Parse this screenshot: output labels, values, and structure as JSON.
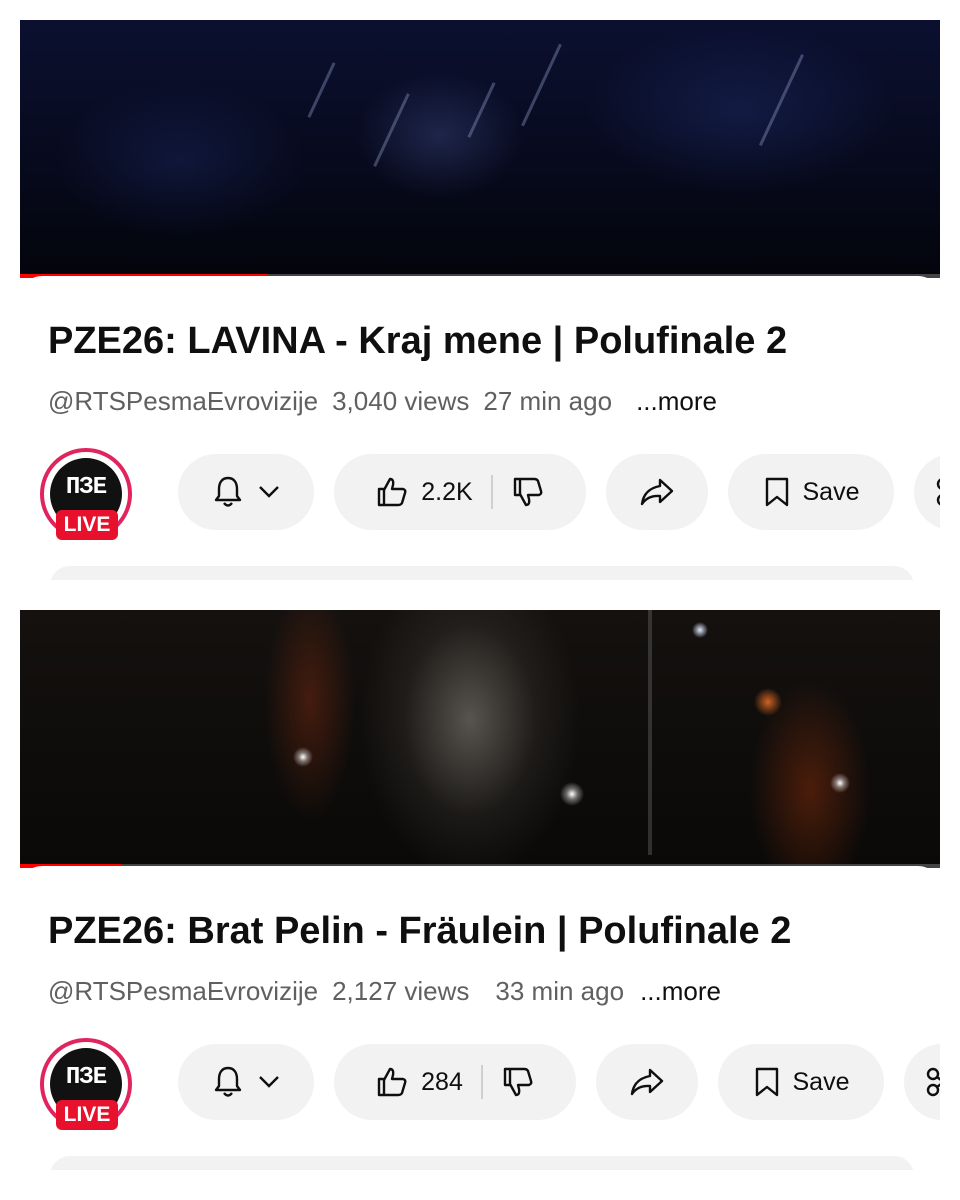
{
  "videos": [
    {
      "title": "PZE26: LAVINA - Kraj mene | Polufinale 2",
      "channel": "@RTSPesmaEvrovizije",
      "views": "3,040 views",
      "time": "27 min ago",
      "more": "...more",
      "likes": "2.2K",
      "save_label": "Save",
      "progress_fraction": 0.27,
      "avatar_logo": "ПЗЕ",
      "avatar_badge": "LIVE"
    },
    {
      "title": "PZE26: Brat Pelin - Fräulein | Polufinale 2",
      "channel": "@RTSPesmaEvrovizije",
      "views": "2,127 views",
      "time": "33 min ago",
      "more": "...more",
      "likes": "284",
      "save_label": "Save",
      "progress_fraction": 0.11,
      "avatar_logo": "ПЗЕ",
      "avatar_badge": "LIVE"
    }
  ],
  "icons": [
    "bell-icon",
    "chevron-down-icon",
    "thumbs-up-icon",
    "thumbs-down-icon",
    "share-icon",
    "bookmark-icon",
    "scissors-icon"
  ],
  "colors": {
    "accent": "#ff0000",
    "live_badge": "#e8112d",
    "pill_bg": "#f2f2f2",
    "meta_text": "#606060"
  }
}
